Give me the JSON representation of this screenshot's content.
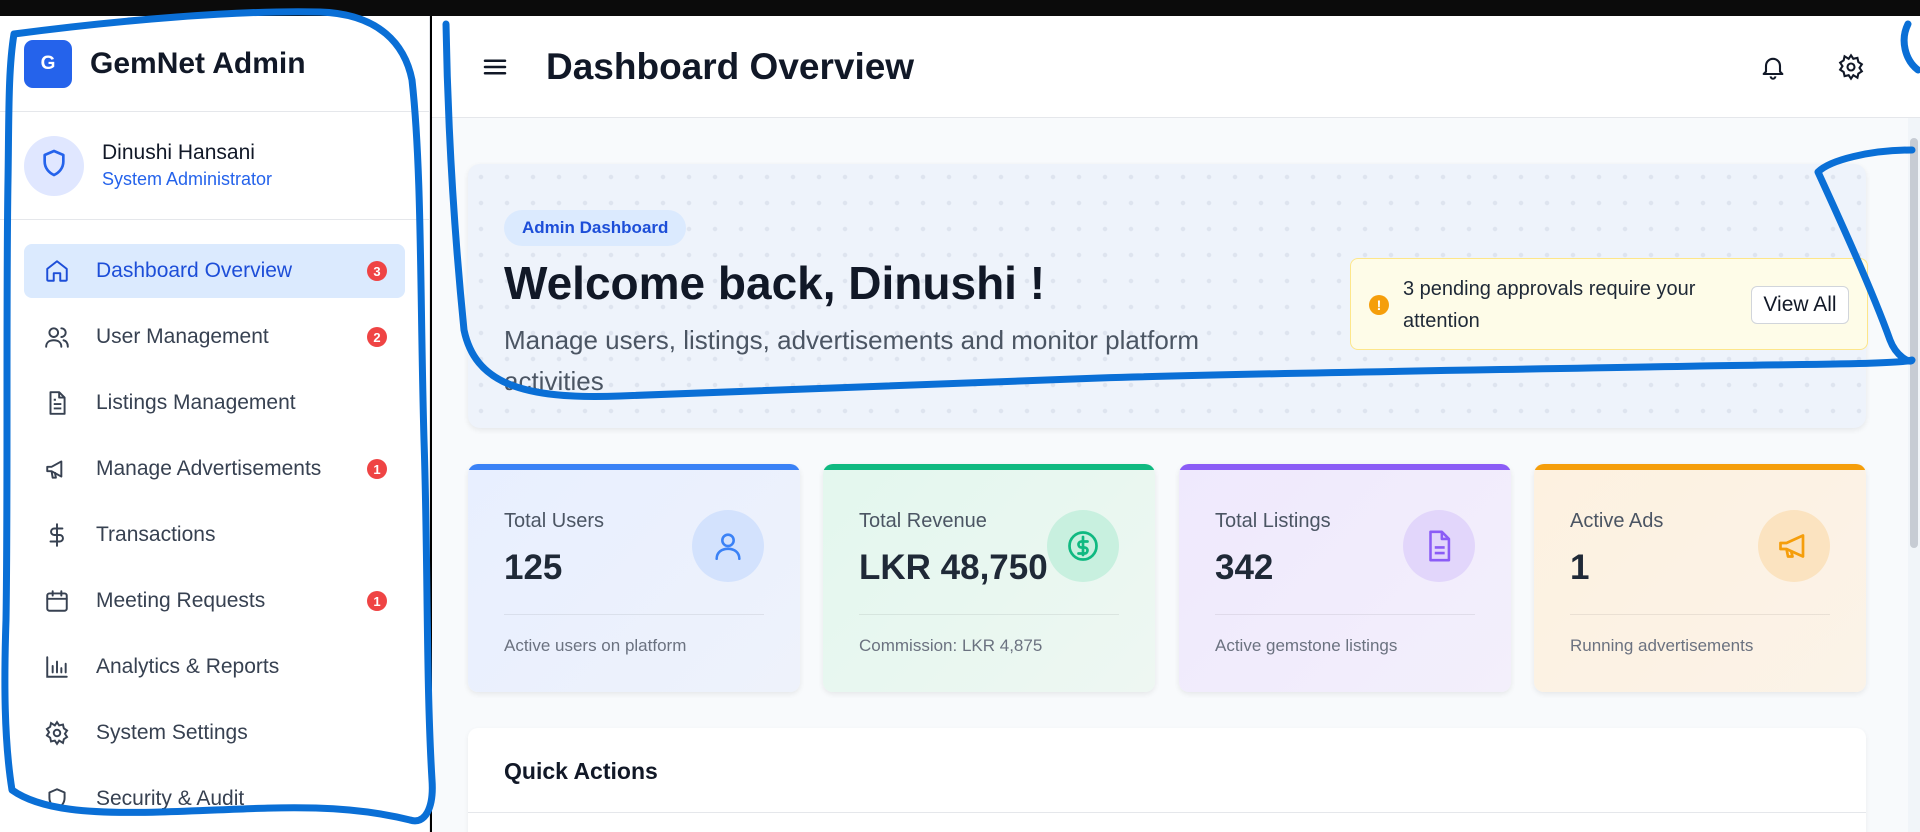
{
  "brand": {
    "logo_letter": "G",
    "name": "GemNet Admin"
  },
  "profile": {
    "name": "Dinushi Hansani",
    "role": "System Administrator",
    "icon": "shield-icon"
  },
  "nav": {
    "items": [
      {
        "label": "Dashboard Overview",
        "icon": "home-icon",
        "badge": "3",
        "active": true
      },
      {
        "label": "User Management",
        "icon": "users-icon",
        "badge": "2"
      },
      {
        "label": "Listings Management",
        "icon": "document-icon",
        "badge": null
      },
      {
        "label": "Manage Advertisements",
        "icon": "megaphone-icon",
        "badge": "1"
      },
      {
        "label": "Transactions",
        "icon": "dollar-icon",
        "badge": null
      },
      {
        "label": "Meeting Requests",
        "icon": "calendar-icon",
        "badge": "1"
      },
      {
        "label": "Analytics & Reports",
        "icon": "bar-chart-icon",
        "badge": null
      },
      {
        "label": "System Settings",
        "icon": "gear-icon",
        "badge": null
      },
      {
        "label": "Security & Audit",
        "icon": "shield-icon",
        "badge": null
      }
    ]
  },
  "header": {
    "title": "Dashboard Overview",
    "icons": [
      "menu-icon",
      "bell-icon",
      "gear-icon"
    ]
  },
  "welcome": {
    "pill": "Admin Dashboard",
    "title": "Welcome back, Dinushi !",
    "subtitle": "Manage users, listings, advertisements and monitor platform activities",
    "alert": {
      "text": "3 pending approvals require your attention",
      "button": "View All"
    }
  },
  "stats": [
    {
      "label": "Total Users",
      "value": "125",
      "footer": "Active users on platform",
      "accent": "#3b82f6",
      "icon": "user-icon"
    },
    {
      "label": "Total Revenue",
      "value": "LKR 48,750",
      "footer": "Commission: LKR 4,875",
      "accent": "#10b981",
      "icon": "dollar-circle-icon"
    },
    {
      "label": "Total Listings",
      "value": "342",
      "footer": "Active gemstone listings",
      "accent": "#8b5cf6",
      "icon": "document-icon"
    },
    {
      "label": "Active Ads",
      "value": "1",
      "footer": "Running advertisements",
      "accent": "#f59e0b",
      "icon": "megaphone-icon"
    }
  ],
  "quick_actions": {
    "title": "Quick Actions"
  },
  "colors": {
    "primary": "#2563eb",
    "badge": "#ef4444",
    "annotation": "#0a6fd6"
  }
}
